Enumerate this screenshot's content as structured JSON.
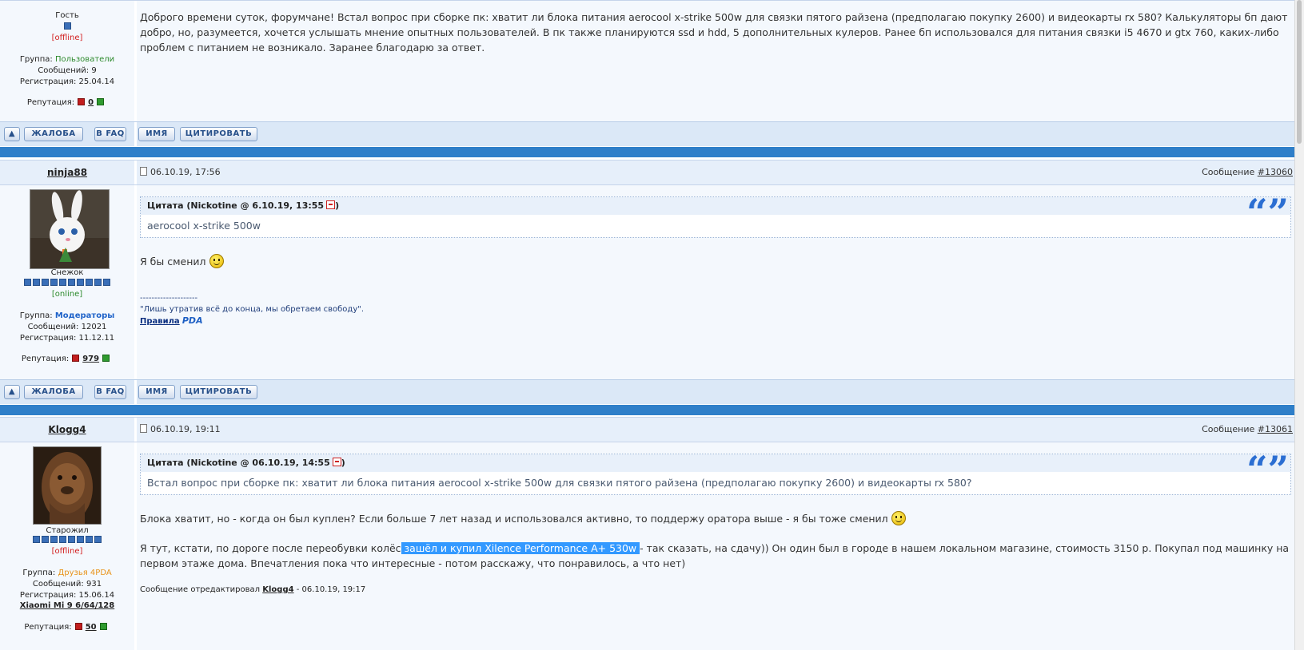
{
  "post1": {
    "author": {
      "role": "Гость",
      "status": "[offline]",
      "group_label": "Группа:",
      "group_value": "Пользователи",
      "msgs": "Сообщений: 9",
      "reg": "Регистрация: 25.04.14",
      "rep_label": "Репутация:",
      "rep_value": "0"
    },
    "text": "Доброго времени суток, форумчане! Встал вопрос при сборке пк: хватит ли блока питания aerocool x-strike 500w для связки пятого райзена (предполагаю покупку 2600) и видеокарты rx 580? Калькуляторы бп дают добро, но, разумеется, хочется услышать мнение опытных пользователей. В пк также планируются ssd и hdd, 5 дополнительных кулеров. Ранее бп использовался для питания связки i5 4670 и gtx 760, каких-либо проблем с питанием не возникало. Заранее благодарю за ответ."
  },
  "buttons": {
    "complaint": "ЖАЛОБА",
    "to_faq": "В FAQ",
    "name": "ИМЯ",
    "quote": "ЦИТИРОВАТЬ"
  },
  "post2": {
    "nick": "ninja88",
    "date": "06.10.19, 17:56",
    "msg_label": "Сообщение",
    "msg_no": "#13060",
    "author": {
      "title": "Снежок",
      "status": "[online]",
      "group_label": "Группа:",
      "group_value": "Модераторы",
      "msgs": "Сообщений: 12021",
      "reg": "Регистрация: 11.12.11",
      "rep_label": "Репутация:",
      "rep_value": "979"
    },
    "quote_header": "Цитата (Nickotine @ 6.10.19, 13:55",
    "quote_header_end": ")",
    "quote_text": "aerocool x-strike 500w",
    "text": "Я бы сменил",
    "sig_line": "--------------------",
    "sig_text": "\"Лишь утратив всё до конца, мы обретаем свободу\".",
    "sig_rules": "Правила",
    "sig_logo": "PDA"
  },
  "post3": {
    "nick": "Klogg4",
    "date": "06.10.19, 19:11",
    "msg_label": "Сообщение",
    "msg_no": "#13061",
    "author": {
      "title": "Старожил",
      "status": "[offline]",
      "group_label": "Группа:",
      "group_value": "Друзья 4PDA",
      "msgs": "Сообщений: 931",
      "reg": "Регистрация: 15.06.14",
      "device": "Xiaomi Mi 9 6/64/128",
      "rep_label": "Репутация:",
      "rep_value": "50"
    },
    "quote_header": "Цитата (Nickotine @ 06.10.19, 14:55",
    "quote_header_end": ")",
    "quote_text": "Встал вопрос при сборке пк: хватит ли блока питания aerocool x-strike 500w для связки пятого райзена (предполагаю покупку 2600) и видеокарты rx 580?",
    "text1": "Блока хватит, но - когда он был куплен? Если больше 7 лет назад и использовался активно, то поддержу оратора выше - я бы тоже сменил",
    "text2_before": "Я тут, кстати, по дороге после переобувки колёс",
    "text2_highlight": " зашёл и купил Xilence Performance A+ 530w ",
    "text2_after": "- так сказать, на сдачу)) Он один был в городе в нашем локальном магазине, стоимость 3150 р. Покупал под машинку на первом этаже дома. Впечатления пока что интересные - потом расскажу, что понравилось, а что нет)",
    "edited_label": "Сообщение отредактировал",
    "edited_by": "Klogg4",
    "edited_date": "- 06.10.19, 19:17"
  }
}
